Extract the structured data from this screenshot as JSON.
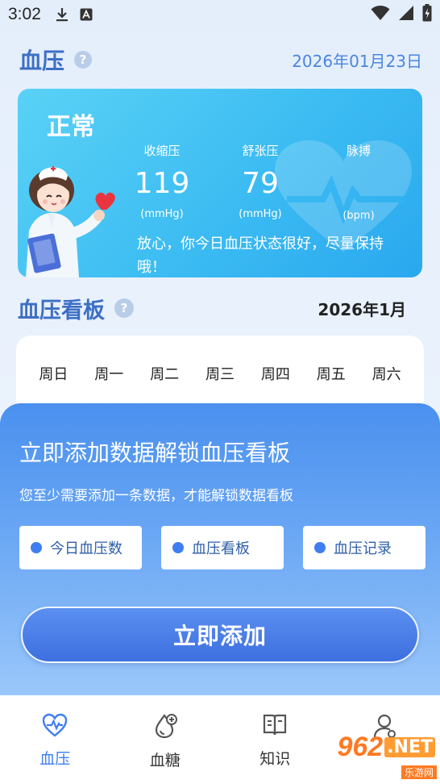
{
  "status_bar": {
    "time": "3:02"
  },
  "header": {
    "title": "血压",
    "date": "2026年01月23日"
  },
  "card": {
    "status": "正常",
    "metrics": [
      {
        "label": "收缩压",
        "value": "119",
        "unit": "(mmHg)"
      },
      {
        "label": "舒张压",
        "value": "79",
        "unit": "(mmHg)"
      },
      {
        "label": "脉搏",
        "value": "",
        "unit": "(bpm)"
      }
    ],
    "message": "放心，你今日血压状态很好，尽量保持哦！"
  },
  "board": {
    "title": "血压看板",
    "month": "2026年1月",
    "weekdays": [
      "周日",
      "周一",
      "周二",
      "周三",
      "周四",
      "周五",
      "周六"
    ]
  },
  "overlay": {
    "title": "立即添加数据解锁血压看板",
    "subtitle": "您至少需要添加一条数据，才能解锁数据看板",
    "features": [
      "今日血压数",
      "血压看板",
      "血压记录"
    ],
    "add_button": "立即添加"
  },
  "nav": {
    "items": [
      {
        "label": "血压",
        "icon": "heart-pulse-icon",
        "active": true
      },
      {
        "label": "血糖",
        "icon": "blood-drop-plus-icon",
        "active": false
      },
      {
        "label": "知识",
        "icon": "book-icon",
        "active": false
      },
      {
        "label": "",
        "icon": "user-icon",
        "active": false
      }
    ]
  },
  "watermark": {
    "logo": "962",
    "net": ".NET",
    "sub": "乐游网"
  },
  "colors": {
    "accent": "#3f7ef0",
    "title": "#3d6fc4",
    "card": "#3cbcf2"
  }
}
